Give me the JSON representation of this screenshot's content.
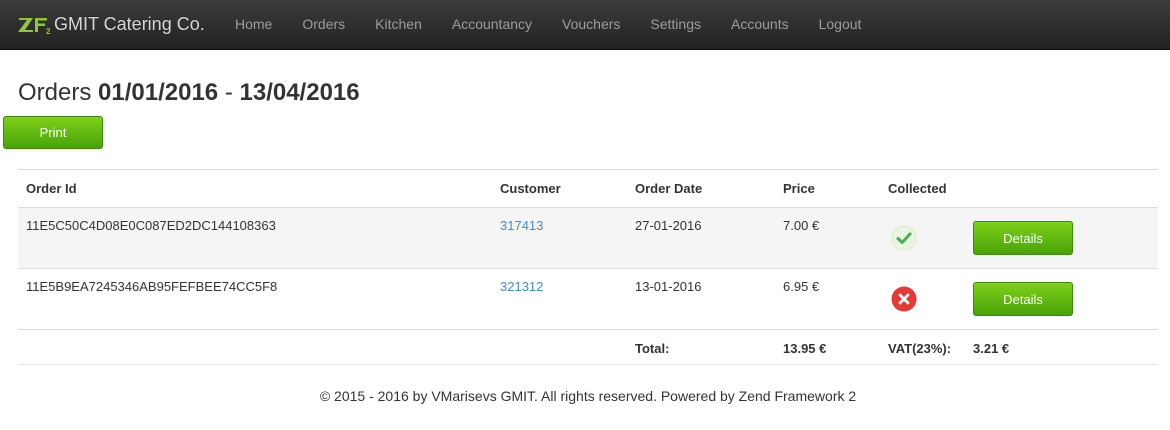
{
  "navbar": {
    "brand": "GMIT Catering Co.",
    "items": [
      "Home",
      "Orders",
      "Kitchen",
      "Accountancy",
      "Vouchers",
      "Settings",
      "Accounts",
      "Logout"
    ]
  },
  "page": {
    "title_prefix": "Orders",
    "date_from": "01/01/2016",
    "date_separator": "-",
    "date_to": "13/04/2016",
    "print_label": "Print"
  },
  "table": {
    "headers": {
      "order_id": "Order Id",
      "customer": "Customer",
      "order_date": "Order Date",
      "price": "Price",
      "collected": "Collected"
    },
    "rows": [
      {
        "order_id": "11E5C50C4D08E0C087ED2DC144108363",
        "customer": "317413",
        "order_date": "27-01-2016",
        "price": "7.00 €",
        "collected": "check-circle-icon",
        "details_label": "Details"
      },
      {
        "order_id": "11E5B9EA7245346AB95FEFBEE74CC5F8",
        "customer": "321312",
        "order_date": "13-01-2016",
        "price": "6.95 €",
        "collected": "cross-circle-icon",
        "details_label": "Details"
      }
    ],
    "total": {
      "label": "Total:",
      "value": "13.95 €",
      "vat_label": "VAT(23%):",
      "vat_value": "3.21 €"
    }
  },
  "footer": {
    "text": "© 2015 - 2016 by VMarisevs GMIT. All rights reserved. Powered by Zend Framework 2"
  },
  "colors": {
    "navbar_bg": "#222222",
    "nav_text": "#9d9d9d",
    "brand_green": "#8dc63f",
    "button_green": "#5cb85c",
    "link_blue": "#428bca",
    "success_green": "#5cb85c",
    "danger_red": "#e53935"
  }
}
